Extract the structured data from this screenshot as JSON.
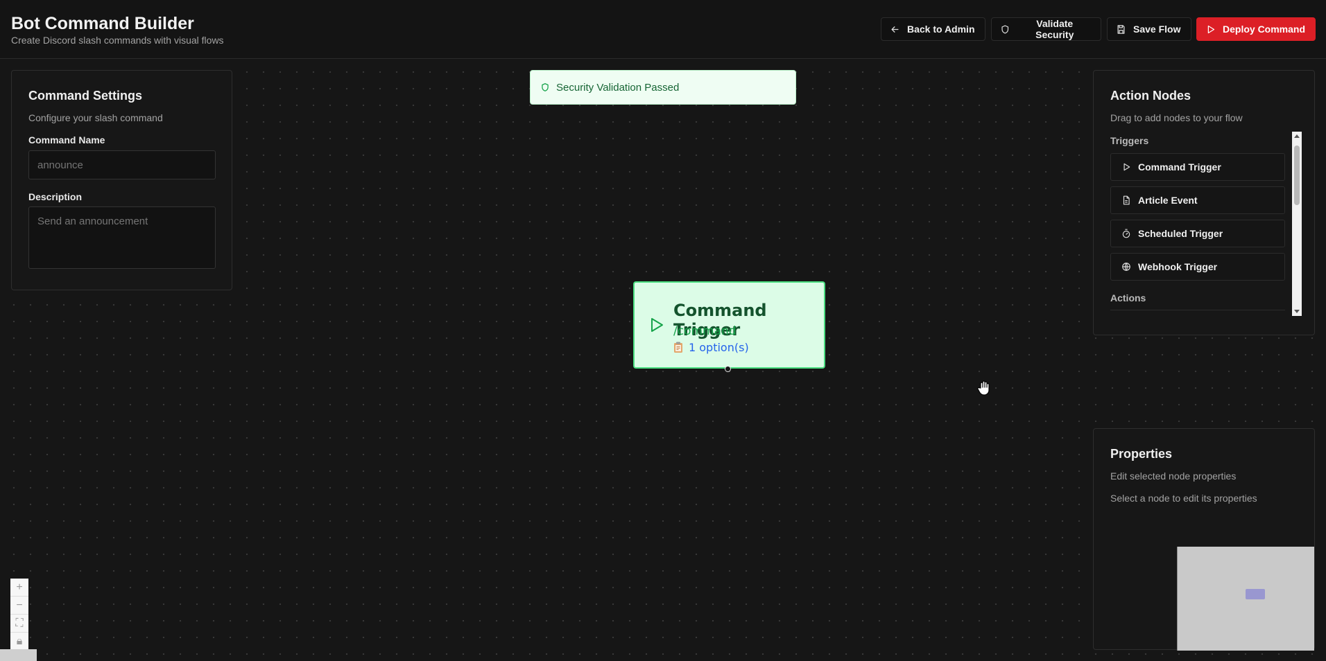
{
  "header": {
    "title": "Bot Command Builder",
    "subtitle": "Create Discord slash commands with visual flows",
    "buttons": {
      "back": "Back to Admin",
      "validate": "Validate Security",
      "save": "Save Flow",
      "deploy": "Deploy Command"
    }
  },
  "command_settings": {
    "title": "Command Settings",
    "subtitle": "Configure your slash command",
    "name_label": "Command Name",
    "name_placeholder": "announce",
    "description_label": "Description",
    "description_placeholder": "Send an announcement"
  },
  "toast": {
    "message": "Security Validation Passed"
  },
  "flow_node": {
    "title": "Command Trigger",
    "command": "/command",
    "options": "1 option(s)"
  },
  "action_nodes": {
    "title": "Action Nodes",
    "subtitle": "Drag to add nodes to your flow",
    "triggers_label": "Triggers",
    "triggers": [
      {
        "label": "Command Trigger",
        "icon": "play-icon"
      },
      {
        "label": "Article Event",
        "icon": "file-icon"
      },
      {
        "label": "Scheduled Trigger",
        "icon": "timer-icon"
      },
      {
        "label": "Webhook Trigger",
        "icon": "globe-icon"
      }
    ],
    "actions_label": "Actions"
  },
  "properties": {
    "title": "Properties",
    "subtitle": "Edit selected node properties",
    "empty": "Select a node to edit its properties"
  },
  "colors": {
    "deploy": "#dc1f26",
    "node_bg": "#dcfce7",
    "node_border": "#4ade80",
    "toast_text": "#166534"
  }
}
